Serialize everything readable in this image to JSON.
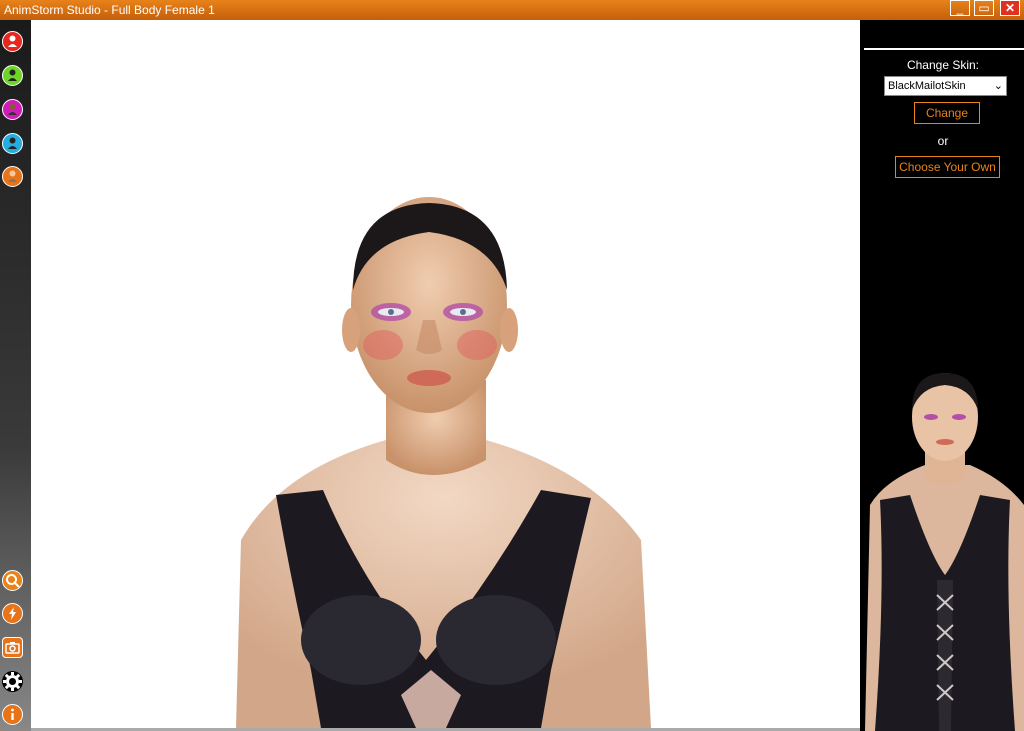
{
  "window": {
    "title": "AnimStorm Studio -  Full Body Female 1",
    "minimize": "_",
    "maximize": "▭",
    "close": "✕"
  },
  "toolbar": {
    "top_tools": [
      {
        "icon": "person-red-icon",
        "color": "#e8261e"
      },
      {
        "icon": "person-green-icon",
        "color": "#6cd626"
      },
      {
        "icon": "person-magenta-icon",
        "color": "#d01aba"
      },
      {
        "icon": "person-cyan-icon",
        "color": "#22aee0"
      },
      {
        "icon": "person-orange-icon",
        "color": "#e8741a"
      }
    ],
    "bottom_tools": [
      {
        "icon": "zoom-icon",
        "glyph": "Q",
        "color": "#e8821a"
      },
      {
        "icon": "lightning-icon",
        "glyph": "⚡",
        "color": "#e8741a"
      },
      {
        "icon": "camera-icon",
        "glyph": "◙",
        "color": "#e8741a"
      },
      {
        "icon": "gear-icon",
        "glyph": "⚙",
        "color": "#000000"
      },
      {
        "icon": "info-icon",
        "glyph": "i",
        "color": "#e8741a"
      }
    ]
  },
  "panel": {
    "change_skin_label": "Change Skin:",
    "skin_value": "BlackMailotSkin",
    "change_button": "Change",
    "or_text": "or",
    "choose_button": "Choose Your Own"
  },
  "colors": {
    "accent": "#e8821a",
    "titlebar": "#d86d12",
    "panel_bg": "#000000",
    "viewport_bg": "#ffffff"
  }
}
